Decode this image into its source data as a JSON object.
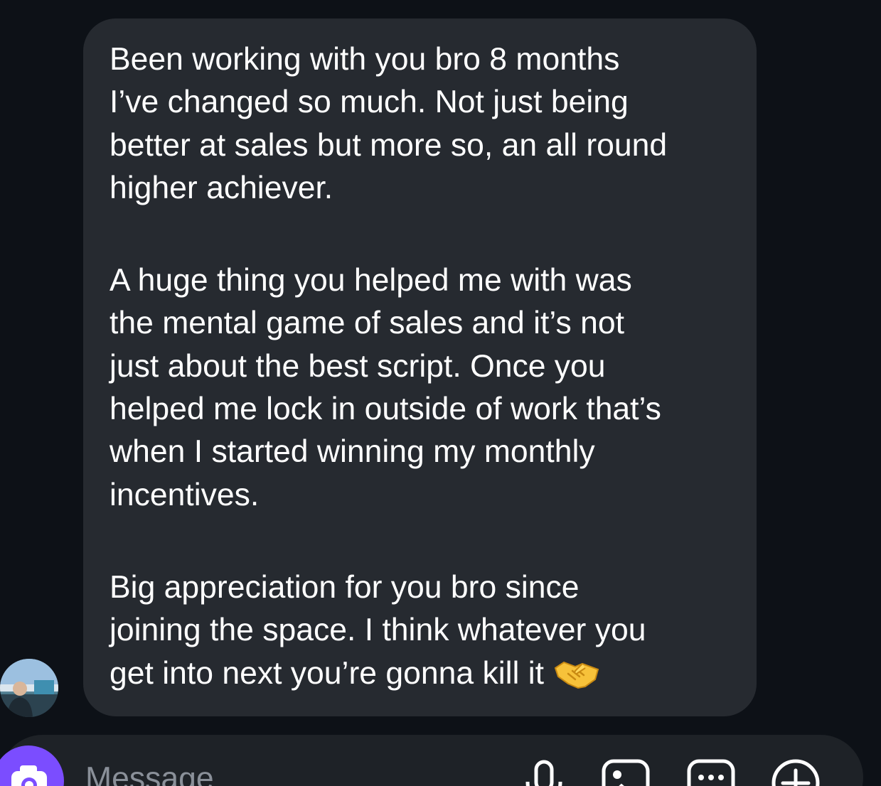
{
  "message": {
    "paragraphs": [
      {
        "lines": [
          "Been working with you bro 8 months",
          "I’ve changed so much. Not just being",
          "better at sales but more so, an all round",
          "higher achiever."
        ]
      },
      {
        "lines": [
          "A huge thing you helped me with was",
          "the mental game of sales and it’s not",
          "just about the best script. Once you",
          "helped me lock in outside of work that’s",
          "when I started winning my monthly",
          "incentives."
        ]
      },
      {
        "lines": [
          "Big appreciation for you bro since",
          "joining the space. I think whatever you",
          "get into next you’re gonna kill it"
        ],
        "trailing_emoji": "handshake-emoji"
      }
    ]
  },
  "composer": {
    "placeholder": "Message",
    "camera_icon": "camera-icon",
    "actions": [
      "microphone-icon",
      "gallery-icon",
      "sticker-icon",
      "plus-icon"
    ]
  },
  "colors": {
    "background": "#0d1117",
    "bubble": "#262a30",
    "composer": "#1e2227",
    "camera_button": "#7b4dff",
    "placeholder": "#8a9099"
  }
}
